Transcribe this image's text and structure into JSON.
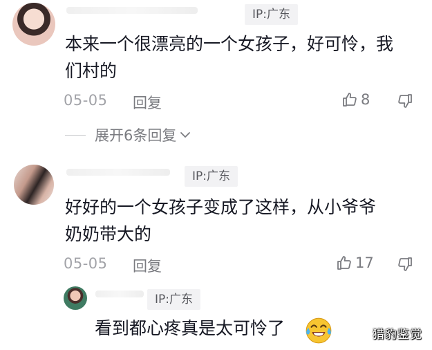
{
  "comments": [
    {
      "ip": "IP:广东",
      "text_lines": [
        "本来一个很漂亮的一个女孩子，好可怜，我",
        "们村的"
      ],
      "date": "05-05",
      "reply_label": "回复",
      "likes": "8",
      "expand_label": "展开6条回复"
    },
    {
      "ip": "IP:广东",
      "text_lines": [
        "好好的一个女孩子变成了这样，从小爷爷",
        "奶奶带大的"
      ],
      "date": "05-05",
      "reply_label": "回复",
      "likes": "17"
    }
  ],
  "reply": {
    "ip": "IP:广东",
    "text": "看到都心疼真是太可怜了"
  },
  "watermark": "猎豹鉴觉",
  "icons": {
    "like": "thumbs-up-icon",
    "dislike": "thumbs-down-icon",
    "chevron": "chevron-down-icon",
    "emoji": "crying-laughing-emoji"
  },
  "colors": {
    "text": "#161823",
    "meta": "#a2a3a8",
    "action": "#7a7b80",
    "ip_badge_bg": "#f2f2f4",
    "emoji": "#f7c531"
  }
}
